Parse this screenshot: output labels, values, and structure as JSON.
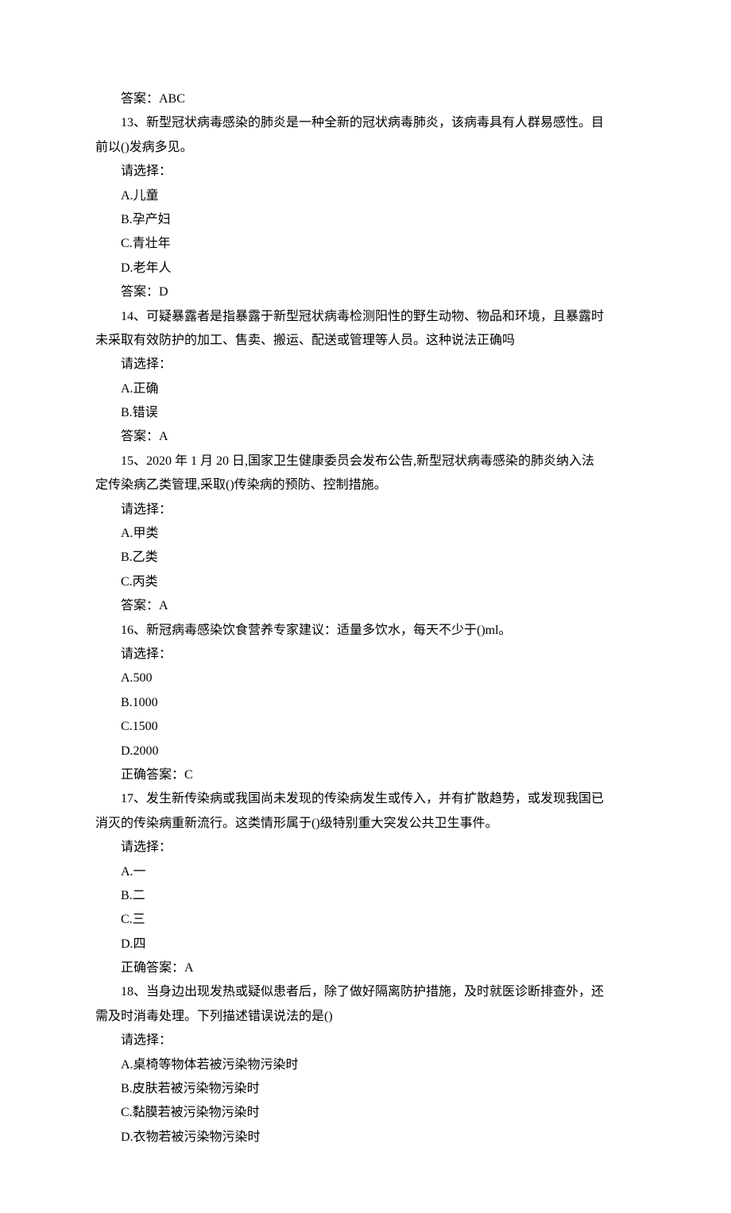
{
  "lines": [
    {
      "cls": "line",
      "path": "q12.answer"
    },
    {
      "cls": "line",
      "path": "q13.stem1"
    },
    {
      "cls": "hanging",
      "path": "q13.stem2"
    },
    {
      "cls": "line",
      "path": "q13.prompt"
    },
    {
      "cls": "line",
      "path": "q13.optA"
    },
    {
      "cls": "line",
      "path": "q13.optB"
    },
    {
      "cls": "line",
      "path": "q13.optC"
    },
    {
      "cls": "line",
      "path": "q13.optD"
    },
    {
      "cls": "line",
      "path": "q13.answer"
    },
    {
      "cls": "line",
      "path": "q14.stem1"
    },
    {
      "cls": "hanging",
      "path": "q14.stem2"
    },
    {
      "cls": "line",
      "path": "q14.prompt"
    },
    {
      "cls": "line",
      "path": "q14.optA"
    },
    {
      "cls": "line",
      "path": "q14.optB"
    },
    {
      "cls": "line",
      "path": "q14.answer"
    },
    {
      "cls": "line",
      "path": "q15.stem1"
    },
    {
      "cls": "hanging",
      "path": "q15.stem2"
    },
    {
      "cls": "line",
      "path": "q15.prompt"
    },
    {
      "cls": "line",
      "path": "q15.optA"
    },
    {
      "cls": "line",
      "path": "q15.optB"
    },
    {
      "cls": "line",
      "path": "q15.optC"
    },
    {
      "cls": "line",
      "path": "q15.answer"
    },
    {
      "cls": "line",
      "path": "q16.stem"
    },
    {
      "cls": "line",
      "path": "q16.prompt"
    },
    {
      "cls": "line",
      "path": "q16.optA"
    },
    {
      "cls": "line",
      "path": "q16.optB"
    },
    {
      "cls": "line",
      "path": "q16.optC"
    },
    {
      "cls": "line",
      "path": "q16.optD"
    },
    {
      "cls": "line",
      "path": "q16.answer"
    },
    {
      "cls": "line",
      "path": "q17.stem1"
    },
    {
      "cls": "hanging",
      "path": "q17.stem2"
    },
    {
      "cls": "line",
      "path": "q17.prompt"
    },
    {
      "cls": "line",
      "path": "q17.optA"
    },
    {
      "cls": "line",
      "path": "q17.optB"
    },
    {
      "cls": "line",
      "path": "q17.optC"
    },
    {
      "cls": "line",
      "path": "q17.optD"
    },
    {
      "cls": "line",
      "path": "q17.answer"
    },
    {
      "cls": "line",
      "path": "q18.stem1"
    },
    {
      "cls": "hanging",
      "path": "q18.stem2"
    },
    {
      "cls": "line",
      "path": "q18.prompt"
    },
    {
      "cls": "line",
      "path": "q18.optA"
    },
    {
      "cls": "line",
      "path": "q18.optB"
    },
    {
      "cls": "line",
      "path": "q18.optC"
    },
    {
      "cls": "line",
      "path": "q18.optD"
    }
  ],
  "q12": {
    "answer": "答案：ABC"
  },
  "q13": {
    "stem1": "13、新型冠状病毒感染的肺炎是一种全新的冠状病毒肺炎，该病毒具有人群易感性。目",
    "stem2": "前以()发病多见。",
    "prompt": "请选择：",
    "optA": "A.儿童",
    "optB": "B.孕产妇",
    "optC": "C.青壮年",
    "optD": "D.老年人",
    "answer": "答案：D"
  },
  "q14": {
    "stem1": "14、可疑暴露者是指暴露于新型冠状病毒检测阳性的野生动物、物品和环境，且暴露时",
    "stem2": "未采取有效防护的加工、售卖、搬运、配送或管理等人员。这种说法正确吗",
    "prompt": "请选择：",
    "optA": "A.正确",
    "optB": "B.错误",
    "answer": "答案：A"
  },
  "q15": {
    "stem1": "15、2020 年 1 月 20 日,国家卫生健康委员会发布公告,新型冠状病毒感染的肺炎纳入法",
    "stem2": "定传染病乙类管理,采取()传染病的预防、控制措施。",
    "prompt": "请选择：",
    "optA": "A.甲类",
    "optB": "B.乙类",
    "optC": "C.丙类",
    "answer": "答案：A"
  },
  "q16": {
    "stem": "16、新冠病毒感染饮食营养专家建议：适量多饮水，每天不少于()ml。",
    "prompt": "请选择：",
    "optA": "A.500",
    "optB": "B.1000",
    "optC": "C.1500",
    "optD": "D.2000",
    "answer": "正确答案：C"
  },
  "q17": {
    "stem1": "17、发生新传染病或我国尚未发现的传染病发生或传入，并有扩散趋势，或发现我国已",
    "stem2": "消灭的传染病重新流行。这类情形属于()级特别重大突发公共卫生事件。",
    "prompt": "请选择：",
    "optA": "A.一",
    "optB": "B.二",
    "optC": "C.三",
    "optD": "D.四",
    "answer": "正确答案：A"
  },
  "q18": {
    "stem1": "18、当身边出现发热或疑似患者后，除了做好隔离防护措施，及时就医诊断排查外，还",
    "stem2": "需及时消毒处理。下列描述错误说法的是()",
    "prompt": "请选择：",
    "optA": "A.桌椅等物体若被污染物污染时",
    "optB": "B.皮肤若被污染物污染时",
    "optC": "C.黏膜若被污染物污染时",
    "optD": "D.衣物若被污染物污染时"
  }
}
